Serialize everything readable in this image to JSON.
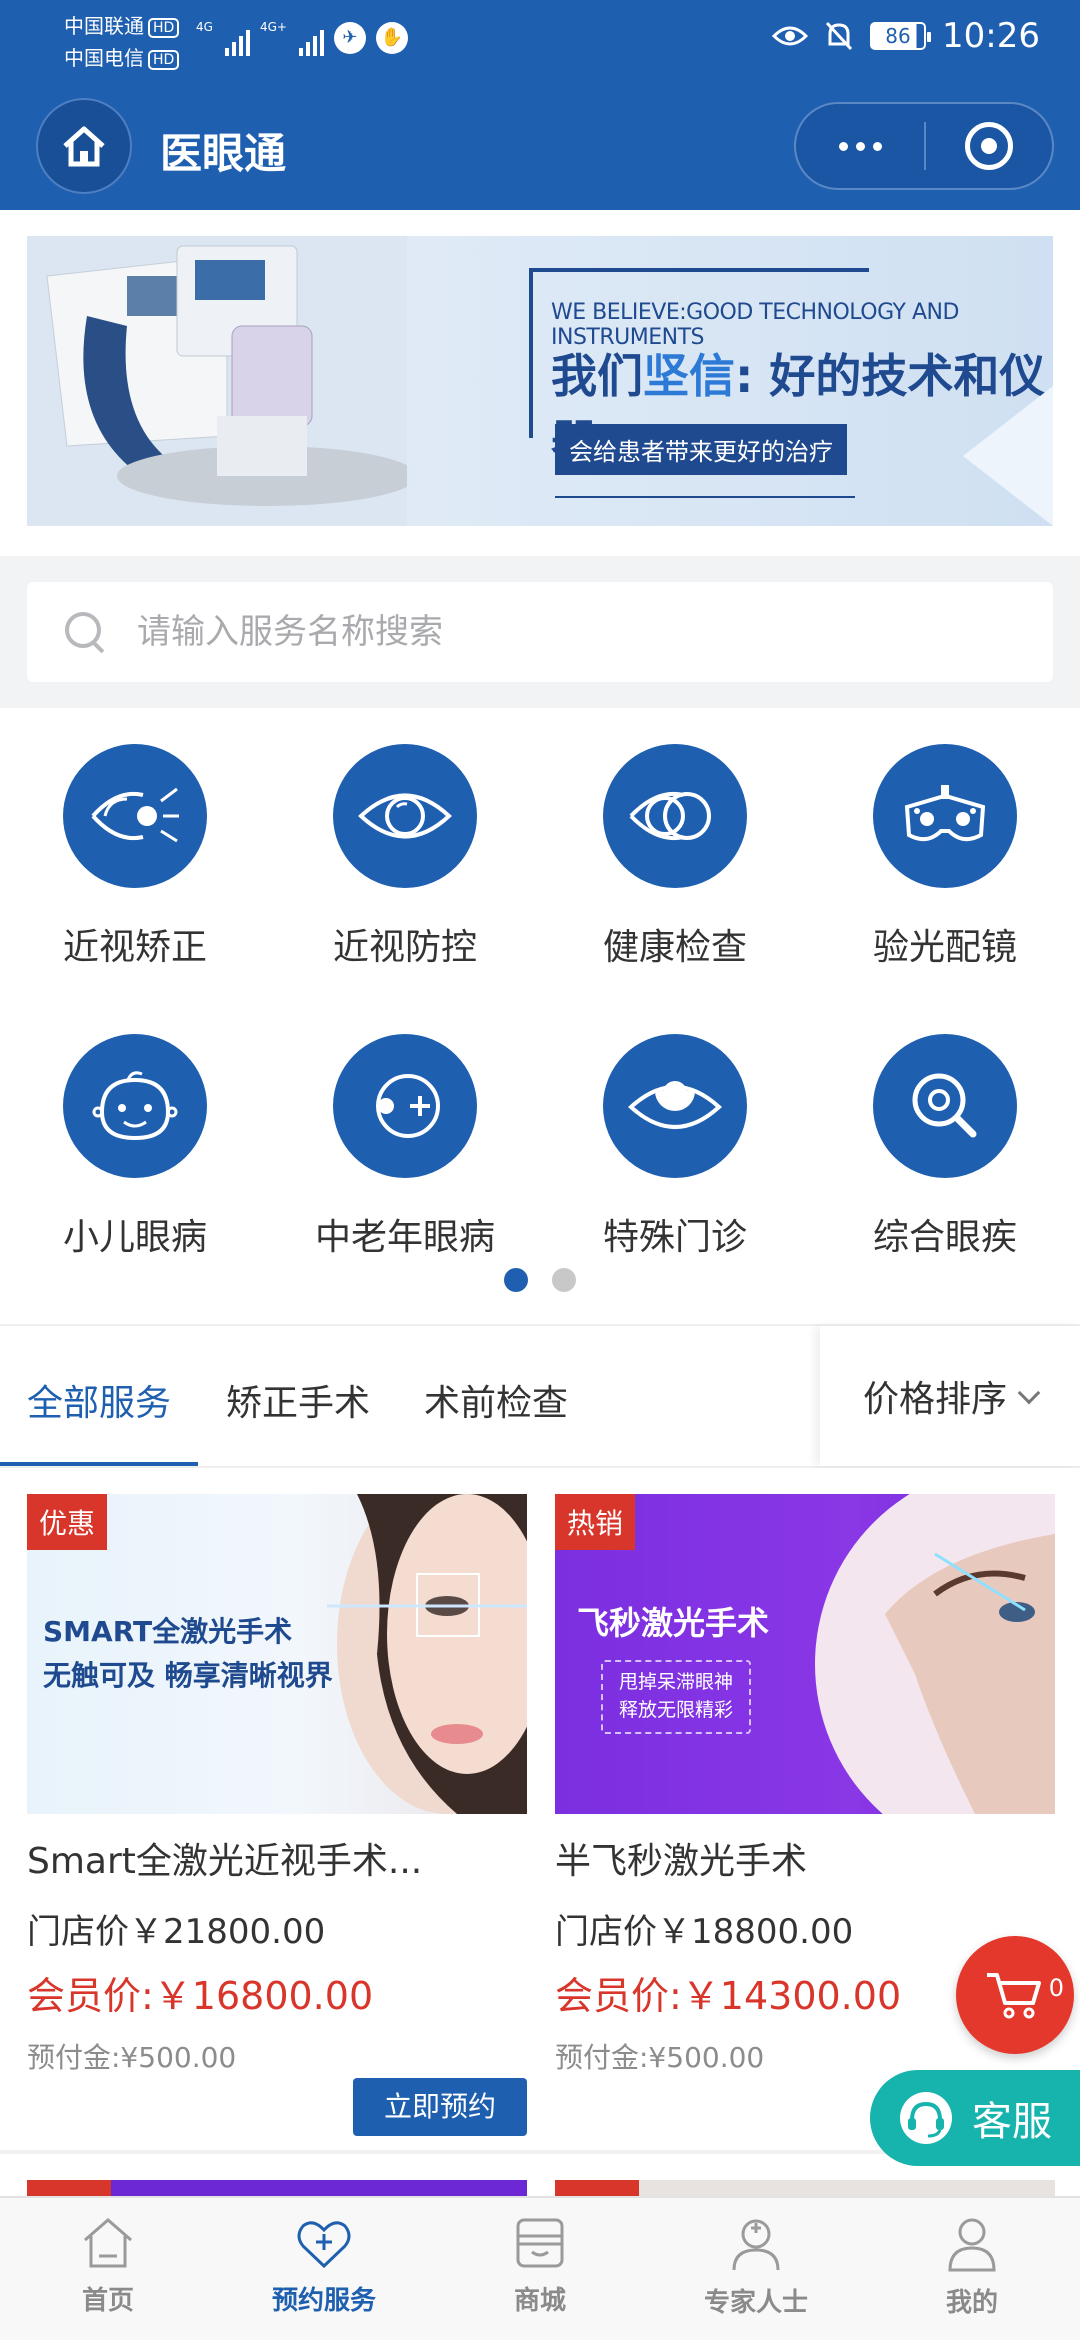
{
  "status_bar": {
    "carrier1": "中国联通",
    "carrier2": "中国电信",
    "hd": "HD",
    "net1": "4G",
    "net2": "4G+",
    "battery": "86",
    "time": "10:26"
  },
  "nav": {
    "title": "医眼通"
  },
  "banner": {
    "en": "WE BELIEVE:GOOD TECHNOLOGY AND INSTRUMENTS",
    "cn_pre": "我们",
    "cn_mid": "坚信",
    "cn_post": ": 好的技术和仪器",
    "sub": "会给患者带来更好的治疗"
  },
  "search": {
    "placeholder": "请输入服务名称搜索"
  },
  "categories": [
    {
      "label": "近视矫正",
      "icon": "laser-eye-icon"
    },
    {
      "label": "近视防控",
      "icon": "eye-icon"
    },
    {
      "label": "健康检查",
      "icon": "double-eye-icon"
    },
    {
      "label": "验光配镜",
      "icon": "phoropter-icon"
    },
    {
      "label": "小儿眼病",
      "icon": "child-face-icon"
    },
    {
      "label": "中老年眼病",
      "icon": "eye-plus-icon"
    },
    {
      "label": "特殊门诊",
      "icon": "open-eye-icon"
    },
    {
      "label": "综合眼疾",
      "icon": "magnifier-eye-icon"
    }
  ],
  "tabs": [
    "全部服务",
    "矫正手术",
    "术前检查"
  ],
  "sort_label": "价格排序",
  "products": [
    {
      "tag": "优惠",
      "img_line1": "SMART全激光手术",
      "img_line2": "无触可及 畅享清晰视界",
      "name": "Smart全激光近视手术...",
      "store_price": "门店价￥21800.00",
      "member_price": "会员价:￥16800.00",
      "deposit": "预付金:¥500.00",
      "button": "立即预约"
    },
    {
      "tag": "热销",
      "img_title": "飞秒激光手术",
      "img_sub1": "甩掉呆滞眼神",
      "img_sub2": "释放无限精彩",
      "name": "半飞秒激光手术",
      "store_price": "门店价￥18800.00",
      "member_price": "会员价:￥14300.00",
      "deposit": "预付金:¥500.00"
    }
  ],
  "cart_count": "0",
  "service_label": "客服",
  "tabbar": [
    {
      "label": "首页",
      "icon": "home-icon"
    },
    {
      "label": "预约服务",
      "icon": "appointment-icon"
    },
    {
      "label": "商城",
      "icon": "shop-icon"
    },
    {
      "label": "专家人士",
      "icon": "doctor-icon"
    },
    {
      "label": "我的",
      "icon": "user-icon"
    }
  ],
  "colors": {
    "primary": "#1f5fb0",
    "red": "#d9362b",
    "teal": "#17b3ad"
  }
}
